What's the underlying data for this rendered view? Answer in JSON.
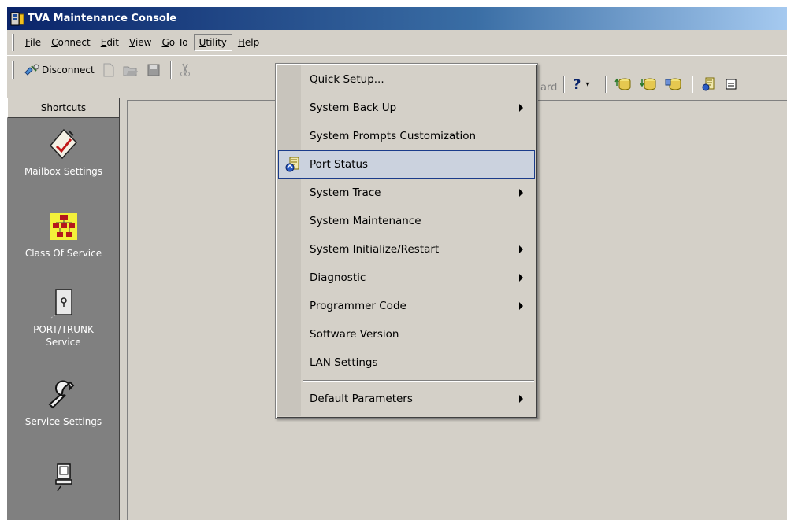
{
  "window": {
    "title": "TVA Maintenance Console"
  },
  "menu": {
    "items": [
      {
        "label": "File",
        "mnemonic": "F",
        "rest": "ile"
      },
      {
        "label": "Connect",
        "mnemonic": "C",
        "rest": "onnect"
      },
      {
        "label": "Edit",
        "mnemonic": "E",
        "rest": "dit"
      },
      {
        "label": "View",
        "mnemonic": "V",
        "rest": "iew"
      },
      {
        "label": "Go To",
        "mnemonic": "G",
        "rest": "o To"
      },
      {
        "label": "Utility",
        "mnemonic": "U",
        "rest": "tility"
      },
      {
        "label": "Help",
        "mnemonic": "H",
        "rest": "elp"
      }
    ]
  },
  "toolbar": {
    "disconnect_label": "Disconnect",
    "partial_label": "ard",
    "help_glyph": "?",
    "icons": [
      "disconnect-icon",
      "new-icon",
      "open-icon",
      "save-icon",
      "cut-icon",
      "help-icon",
      "db-upload-icon",
      "db-download-icon",
      "db-icon",
      "port-status-icon",
      "window-icon"
    ]
  },
  "shortcuts": {
    "header": "Shortcuts",
    "items": [
      {
        "label": "Mailbox Settings",
        "icon": "mailbox-settings-icon"
      },
      {
        "label": "Class Of Service",
        "icon": "class-of-service-icon"
      },
      {
        "label_line1": "PORT/TRUNK",
        "label_line2": "Service",
        "icon": "port-trunk-icon"
      },
      {
        "label": "Service Settings",
        "icon": "service-settings-icon"
      },
      {
        "label": "",
        "icon": "computer-icon"
      }
    ]
  },
  "utility_menu": {
    "items": [
      {
        "label": "Quick Setup...",
        "submenu": false
      },
      {
        "label": "System Back Up",
        "submenu": true
      },
      {
        "label": "System Prompts Customization",
        "submenu": false
      },
      {
        "label": "Port Status",
        "submenu": false,
        "selected": true,
        "icon": "port-status-icon"
      },
      {
        "label": "System Trace",
        "submenu": true
      },
      {
        "label": "System Maintenance",
        "submenu": false
      },
      {
        "label": "System Initialize/Restart",
        "submenu": true
      },
      {
        "label": "Diagnostic",
        "submenu": true
      },
      {
        "label": "Programmer Code",
        "submenu": true
      },
      {
        "label": "Software Version",
        "submenu": false
      },
      {
        "label": "LAN Settings",
        "mnemonic": "L",
        "rest": "AN Settings",
        "submenu": false
      },
      {
        "label": "Default Parameters",
        "submenu": true
      }
    ]
  },
  "colors": {
    "face": "#d4d0c8",
    "title_start": "#0a246a",
    "title_end": "#a6caf0",
    "shortcut_panel": "#808080",
    "selection_border": "#1b3c8a",
    "selection_fill": "#cbd2de"
  }
}
